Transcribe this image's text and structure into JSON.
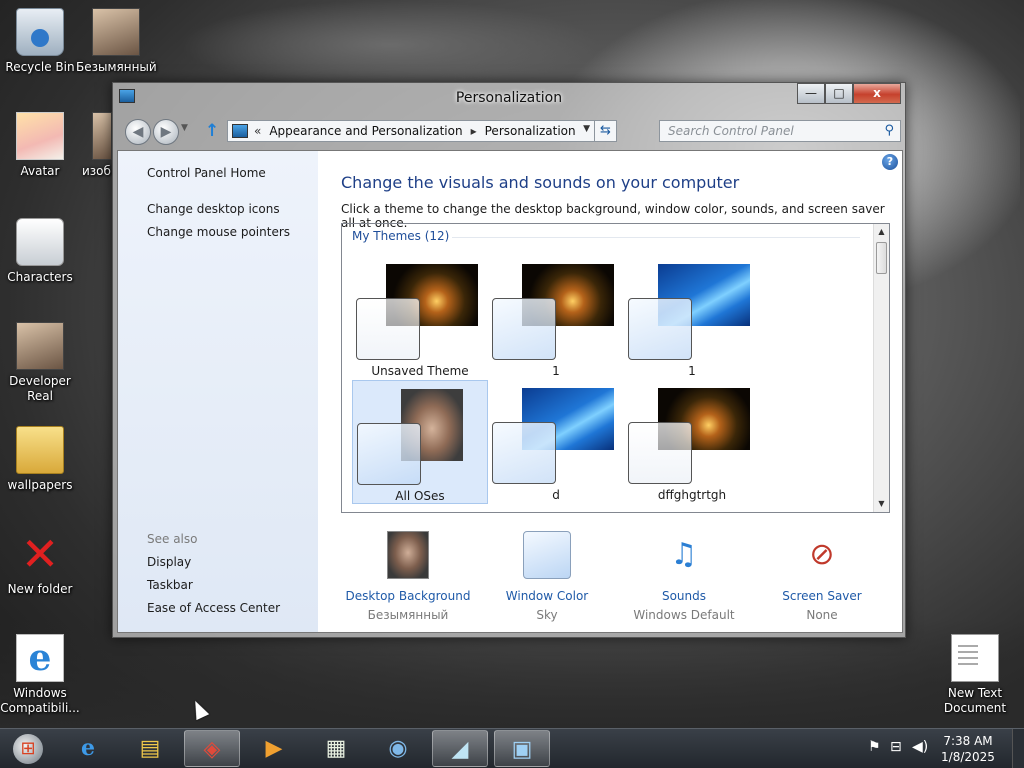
{
  "desktop": {
    "icons": [
      {
        "label": "Recycle Bin"
      },
      {
        "label": "Безымянный"
      },
      {
        "label": "Avatar"
      },
      {
        "label": "изоб"
      },
      {
        "label": "Characters"
      },
      {
        "label": "Developer Real"
      },
      {
        "label": "wallpapers"
      },
      {
        "label": "New folder"
      },
      {
        "label": "Windows Compatibili..."
      },
      {
        "label": "New Text Document"
      }
    ]
  },
  "window": {
    "title": "Personalization",
    "caption": {
      "minimize": "—",
      "maximize": "□",
      "close": "x"
    },
    "nav": {
      "back": "◀",
      "forward": "▶",
      "up": "↑",
      "breadcrumb_prefix": "«",
      "breadcrumbs": [
        "Appearance and Personalization",
        "Personalization"
      ],
      "separator": "▸",
      "search_placeholder": "Search Control Panel"
    },
    "left_pane": {
      "links": [
        "Control Panel Home",
        "Change desktop icons",
        "Change mouse pointers"
      ],
      "see_also_label": "See also",
      "see_also": [
        "Display",
        "Taskbar",
        "Ease of Access Center"
      ]
    },
    "main": {
      "heading": "Change the visuals and sounds on your computer",
      "subheading": "Click a theme to change the desktop background, window color, sounds, and screen saver all at once.",
      "group_label": "My Themes (12)",
      "themes": [
        {
          "name": "Unsaved Theme",
          "background": "gold",
          "selected": false
        },
        {
          "name": "1",
          "background": "gold",
          "selected": false
        },
        {
          "name": "1",
          "background": "blue",
          "selected": false
        },
        {
          "name": "All OSes",
          "background": "face",
          "selected": true
        },
        {
          "name": "d",
          "background": "blue",
          "selected": false
        },
        {
          "name": "dffghgtrtgh",
          "background": "gold",
          "selected": false
        }
      ],
      "bottom": [
        {
          "label": "Desktop Background",
          "value": "Безымянный",
          "icon": "photo-icon"
        },
        {
          "label": "Window Color",
          "value": "Sky",
          "icon": "color-swatch-icon"
        },
        {
          "label": "Sounds",
          "value": "Windows Default",
          "icon": "music-notes-icon"
        },
        {
          "label": "Screen Saver",
          "value": "None",
          "icon": "screen-saver-icon"
        }
      ]
    }
  },
  "taskbar": {
    "clock_time": "7:38 AM",
    "clock_date": "1/8/2025",
    "pinned": [
      "internet-explorer-icon",
      "file-explorer-icon",
      "app-red-icon",
      "media-player-icon",
      "document-app-icon",
      "globe-app-icon",
      "glass-app-icon",
      "control-panel-icon"
    ]
  }
}
